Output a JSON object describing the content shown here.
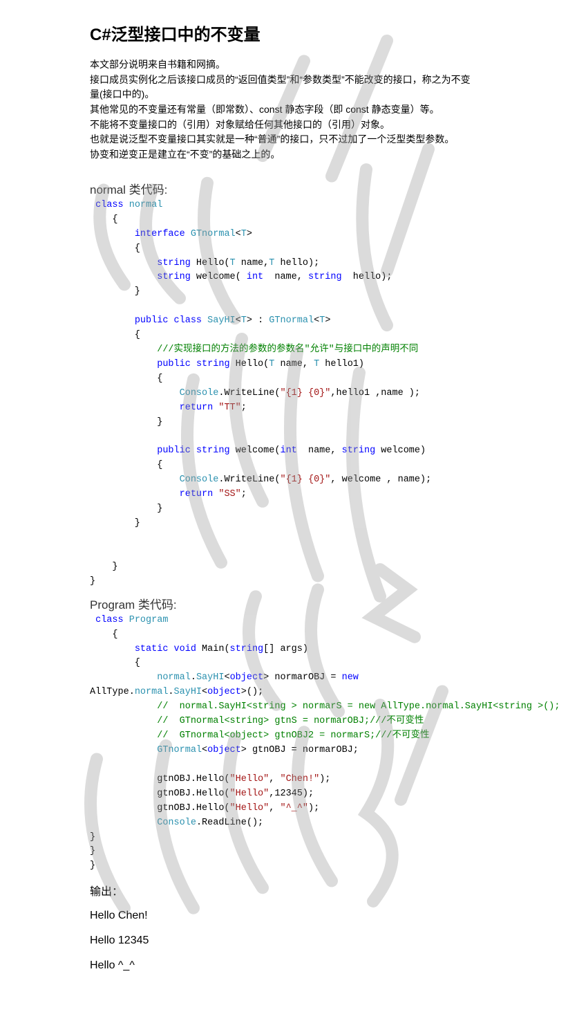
{
  "title": {
    "cs": "C#",
    "rest": "泛型接口中的不变量"
  },
  "desc": {
    "l1": "本文部分说明来自书籍和网摘。",
    "l2": "接口成员实例化之后该接口成员的“返回值类型”和“参数类型”不能改变的接口，称之为不变量(接口中的)。",
    "l3": "其他常见的不变量还有常量（即常数）、const 静态字段（即 const 静态变量）等。",
    "l4": "不能将不变量接口的（引用）对象赋给任何其他接口的（引用）对象。",
    "l5": "也就是说泛型不变量接口其实就是一种“普通”的接口，只不过加了一个泛型类型参数。",
    "l6": "协变和逆变正是建立在“不变”的基础之上的。"
  },
  "sec": {
    "normal": "normal 类代码:",
    "program": "Program  类代码:",
    "output": "输出："
  },
  "kw": {
    "class": "class",
    "interface": "interface",
    "string": "string",
    "int": "int",
    "public": "public",
    "void": "void",
    "static": "static",
    "return": "return",
    "new": "new",
    "object": "object"
  },
  "ty": {
    "normal": "normal",
    "GTnormal": "GTnormal",
    "T": "T",
    "SayHI": "SayHI",
    "Console": "Console",
    "Program": "Program"
  },
  "code1": {
    "hello_sig_a": " Hello(",
    "hello_sig_b": " name,",
    "hello_sig_c": " hello);",
    "welcome_sig_a": " welcome( ",
    "welcome_sig_b": "  name, ",
    "welcome_sig_c": "  hello);",
    "sayhi_a": " ",
    "sayhi_b": "<",
    "sayhi_c": "> : ",
    "sayhi_d": "<",
    "sayhi_e": ">",
    "comment": "///实现接口的方法的参数的参数名\"允许\"与接口中的声明不同",
    "hello_impl_a": " Hello(",
    "hello_impl_b": " name, ",
    "hello_impl_c": " hello1)",
    "wl1_a": ".WriteLine(",
    "wl1_str": "\"{1} {0}\"",
    "wl1_b": ",hello1 ,name );",
    "ret1": "\"TT\"",
    "welcome_impl_a": " welcome(",
    "welcome_impl_b": "  name, ",
    "welcome_impl_c": " welcome)",
    "wl2_a": ".WriteLine(",
    "wl2_str": "\"{1} {0}\"",
    "wl2_b": ", welcome , name);",
    "ret2": "\"SS\""
  },
  "code2": {
    "main_a": " Main(",
    "main_b": "[] args)",
    "line1_a": ".",
    "line1_b": "<",
    "line1_c": "> normarOBJ = ",
    "line1_d": "AllType.",
    "line1_e": ".",
    "line1_f": "<",
    "line1_g": ">();",
    "cmt1": "  //  normal.SayHI<string > normarS = new AllType.normal.SayHI<string >();",
    "cmt2": "   //  GTnormal<string> gtnS = normarOBJ;///不可变性",
    "cmt3": "  //  GTnormal<object> gtnOBJ2 = normarS;///不可变性",
    "line2_a": "<",
    "line2_b": "> gtnOBJ = normarOBJ;",
    "call1_a": "gtnOBJ.Hello(",
    "call1_s1": "\"Hello\"",
    "call1_c": ", ",
    "call1_s2": "\"Chen!\"",
    "call1_e": ");",
    "call2_a": "gtnOBJ.Hello(",
    "call2_s1": "\"Hello\"",
    "call2_e": ",12345);",
    "call3_a": "gtnOBJ.Hello(",
    "call3_s1": "\"Hello\"",
    "call3_c": ", ",
    "call3_s2": "\"^_^\"",
    "call3_e": ");",
    "readline": ".ReadLine();"
  },
  "output": {
    "l1": "Hello Chen!",
    "l2": "Hello 12345",
    "l3": "Hello ^_^"
  }
}
